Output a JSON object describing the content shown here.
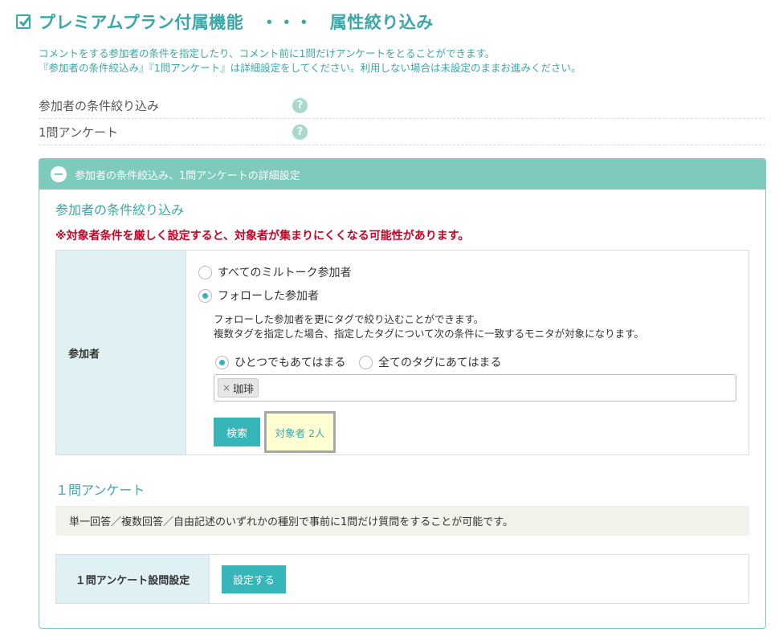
{
  "title": "プレミアムプラン付属機能　・・・　属性絞り込み",
  "description": [
    "コメントをする参加者の条件を指定したり、コメント前に1問だけアンケートをとることができます。",
    "『参加者の条件絞込み』『1問アンケート』は詳細設定をしてください。利用しない場合は未設定のままお進みください。"
  ],
  "options": [
    {
      "label": "参加者の条件絞り込み",
      "help": "?"
    },
    {
      "label": "1問アンケート",
      "help": "?"
    }
  ],
  "panel": {
    "header": "参加者の条件絞込み、1問アンケートの詳細設定",
    "filter": {
      "title": "参加者の条件絞り込み",
      "warning": "※対象者条件を厳しく設定すると、対象者が集まりにくくなる可能性があります。",
      "row_label": "参加者",
      "radio_all": "すべてのミルトーク参加者",
      "radio_followed": "フォローした参加者",
      "selected": "followed",
      "sub_desc": [
        "フォローした参加者を更にタグで絞り込むことができます。",
        "複数タグを指定した場合、指定したタグについて次の条件に一致するモニタが対象になります。"
      ],
      "match_any": "ひとつでもあてはまる",
      "match_all": "全てのタグにあてはまる",
      "match_selected": "any",
      "tags": [
        {
          "remove": "×",
          "label": "珈琲"
        }
      ],
      "search_label": "検索",
      "count_text": "対象者 2人"
    },
    "survey": {
      "title": "１問アンケート",
      "desc": "単一回答／複数回答／自由記述のいずれかの種別で事前に1問だけ質問をすることが可能です。",
      "row_label": "１問アンケート設問設定",
      "button_label": "設定する"
    }
  },
  "colors": {
    "accent": "#3aa7a8",
    "panel_header": "#7ecabd",
    "button": "#36b6b9",
    "warning": "#cc0022",
    "table_header": "#dff1f4"
  }
}
